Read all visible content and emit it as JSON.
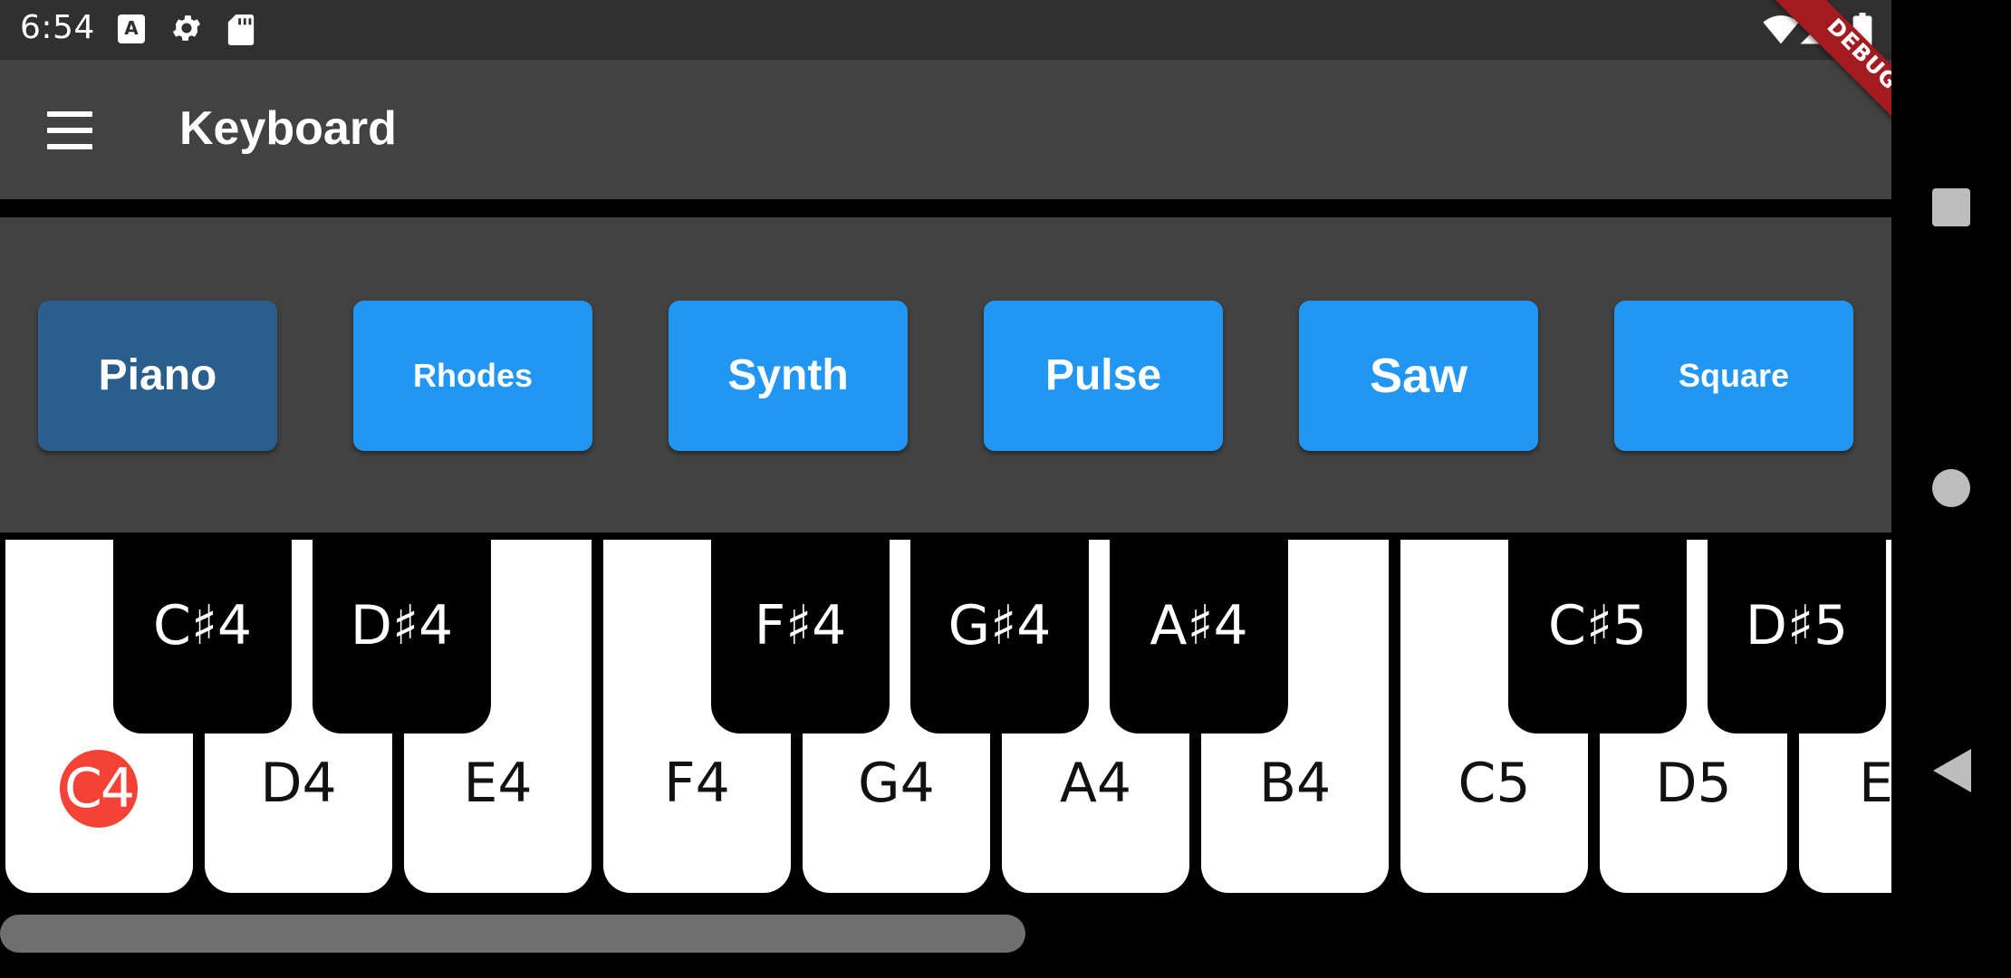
{
  "status_bar": {
    "time": "6:54",
    "left_icons": [
      "text-badge-icon",
      "gear-icon",
      "sd-card-icon"
    ],
    "right_icons": [
      "wifi-icon",
      "signal-icon",
      "battery-icon"
    ],
    "a_badge": "A"
  },
  "debug_banner": "DEBUG",
  "app_bar": {
    "title": "Keyboard",
    "menu_icon": "menu-icon"
  },
  "instruments": {
    "selected": "Piano",
    "buttons": [
      "Piano",
      "Rhodes",
      "Synth",
      "Pulse",
      "Saw",
      "Square"
    ]
  },
  "keyboard": {
    "highlighted_key": "C4",
    "white_keys": [
      "C4",
      "D4",
      "E4",
      "F4",
      "G4",
      "A4",
      "B4",
      "C5",
      "D5",
      "E"
    ],
    "black_keys": [
      "C♯4",
      "D♯4",
      "F♯4",
      "G♯4",
      "A♯4",
      "C♯5",
      "D♯5"
    ]
  },
  "colors": {
    "accent": "#2196f3",
    "selected": "#2a5e8c",
    "highlight": "#f44336",
    "app_bar": "#424242",
    "debug": "#a21b21"
  },
  "nav_bar": {
    "icons": [
      "recents-icon",
      "home-icon",
      "back-icon"
    ]
  }
}
